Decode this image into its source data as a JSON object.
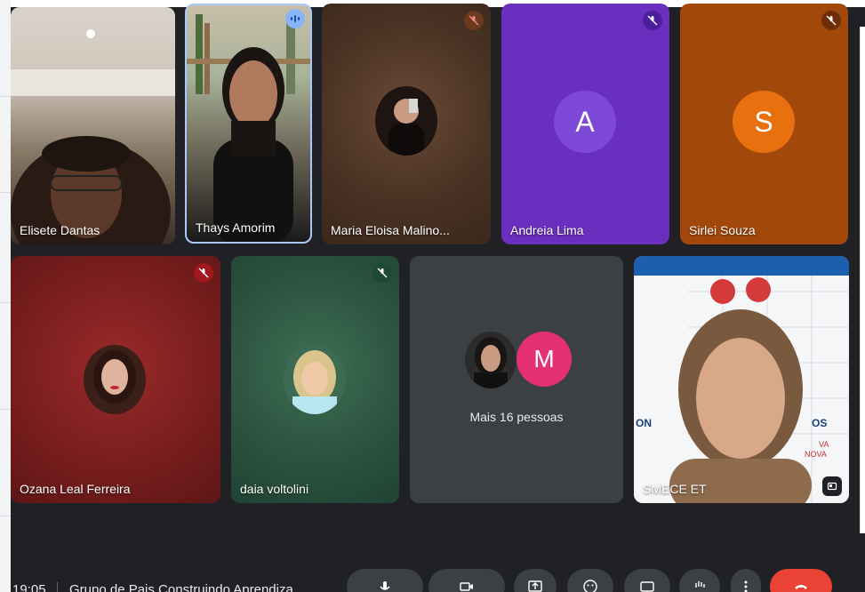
{
  "participants": [
    {
      "name": "Elisete Dantas"
    },
    {
      "name": "Thays Amorim"
    },
    {
      "name": "Maria Eloisa Malino..."
    },
    {
      "name": "Andreia Lima",
      "initial": "A"
    },
    {
      "name": "Sirlei Souza",
      "initial": "S"
    },
    {
      "name": "Ozana Leal Ferreira"
    },
    {
      "name": "daia voltolini"
    },
    {
      "name": "SMECE ET"
    }
  ],
  "more_tile": {
    "text": "Mais 16 pessoas",
    "initial": "M"
  },
  "footer": {
    "time": "19:05",
    "meeting_title": "Grupo de Pais Construindo Aprendiza"
  },
  "colors": {
    "andreia_bg": "#6a2fbf",
    "andreia_avatar": "#7e49d6",
    "sirlei_bg": "#a2480b",
    "sirlei_avatar": "#e8700f",
    "more_avatar": "#e53173",
    "hangup": "#ea4335"
  },
  "icons": [
    "mic-off-icon",
    "speaking-icon",
    "mic-icon",
    "camera-icon",
    "present-icon",
    "emoji-icon",
    "captions-icon",
    "raise-hand-icon",
    "more-options-icon",
    "hangup-icon",
    "pin-icon"
  ]
}
